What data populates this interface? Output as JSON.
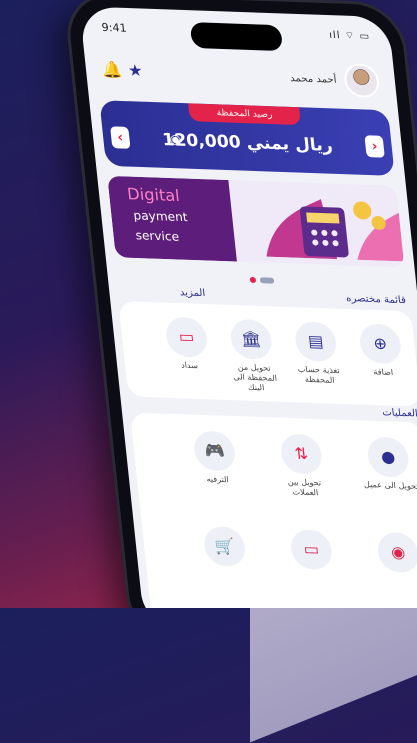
{
  "status_bar": {
    "time": "9:41",
    "icons": "ıll ⌔ ▭"
  },
  "header": {
    "user_name": "أحمد محمد",
    "bell_icon": "bell-icon",
    "star_icon": "star-icon"
  },
  "wallet": {
    "title": "رصيد المحفظة",
    "balance": "120,000 ريال يمني"
  },
  "banner": {
    "line1": "Digital",
    "line2": "payment",
    "line3": "service"
  },
  "quick_actions": {
    "title": "قائمة مختصره",
    "more": "المزيد",
    "items": [
      {
        "label": "اضافة",
        "icon": "add-icon"
      },
      {
        "label": "تغذية حساب المحفظة",
        "icon": "top-up-icon"
      },
      {
        "label": "تحويل من المحفظة الى البنك",
        "icon": "bank-icon"
      },
      {
        "label": "سداد",
        "icon": "card-pay-icon"
      }
    ]
  },
  "operations": {
    "title": "العمليات",
    "items": [
      {
        "label": "تحويل الى عميل",
        "icon": "transfer-user-icon"
      },
      {
        "label": "تحويل بين العملات",
        "icon": "currency-exchange-icon"
      },
      {
        "label": "الترفيه",
        "icon": "gamepad-icon"
      },
      {
        "label": "",
        "icon": "coins-icon"
      },
      {
        "label": "",
        "icon": "card-icon"
      },
      {
        "label": "",
        "icon": "cart-icon"
      }
    ]
  },
  "colors": {
    "primary": "#2b2f93",
    "accent": "#e4234a"
  }
}
